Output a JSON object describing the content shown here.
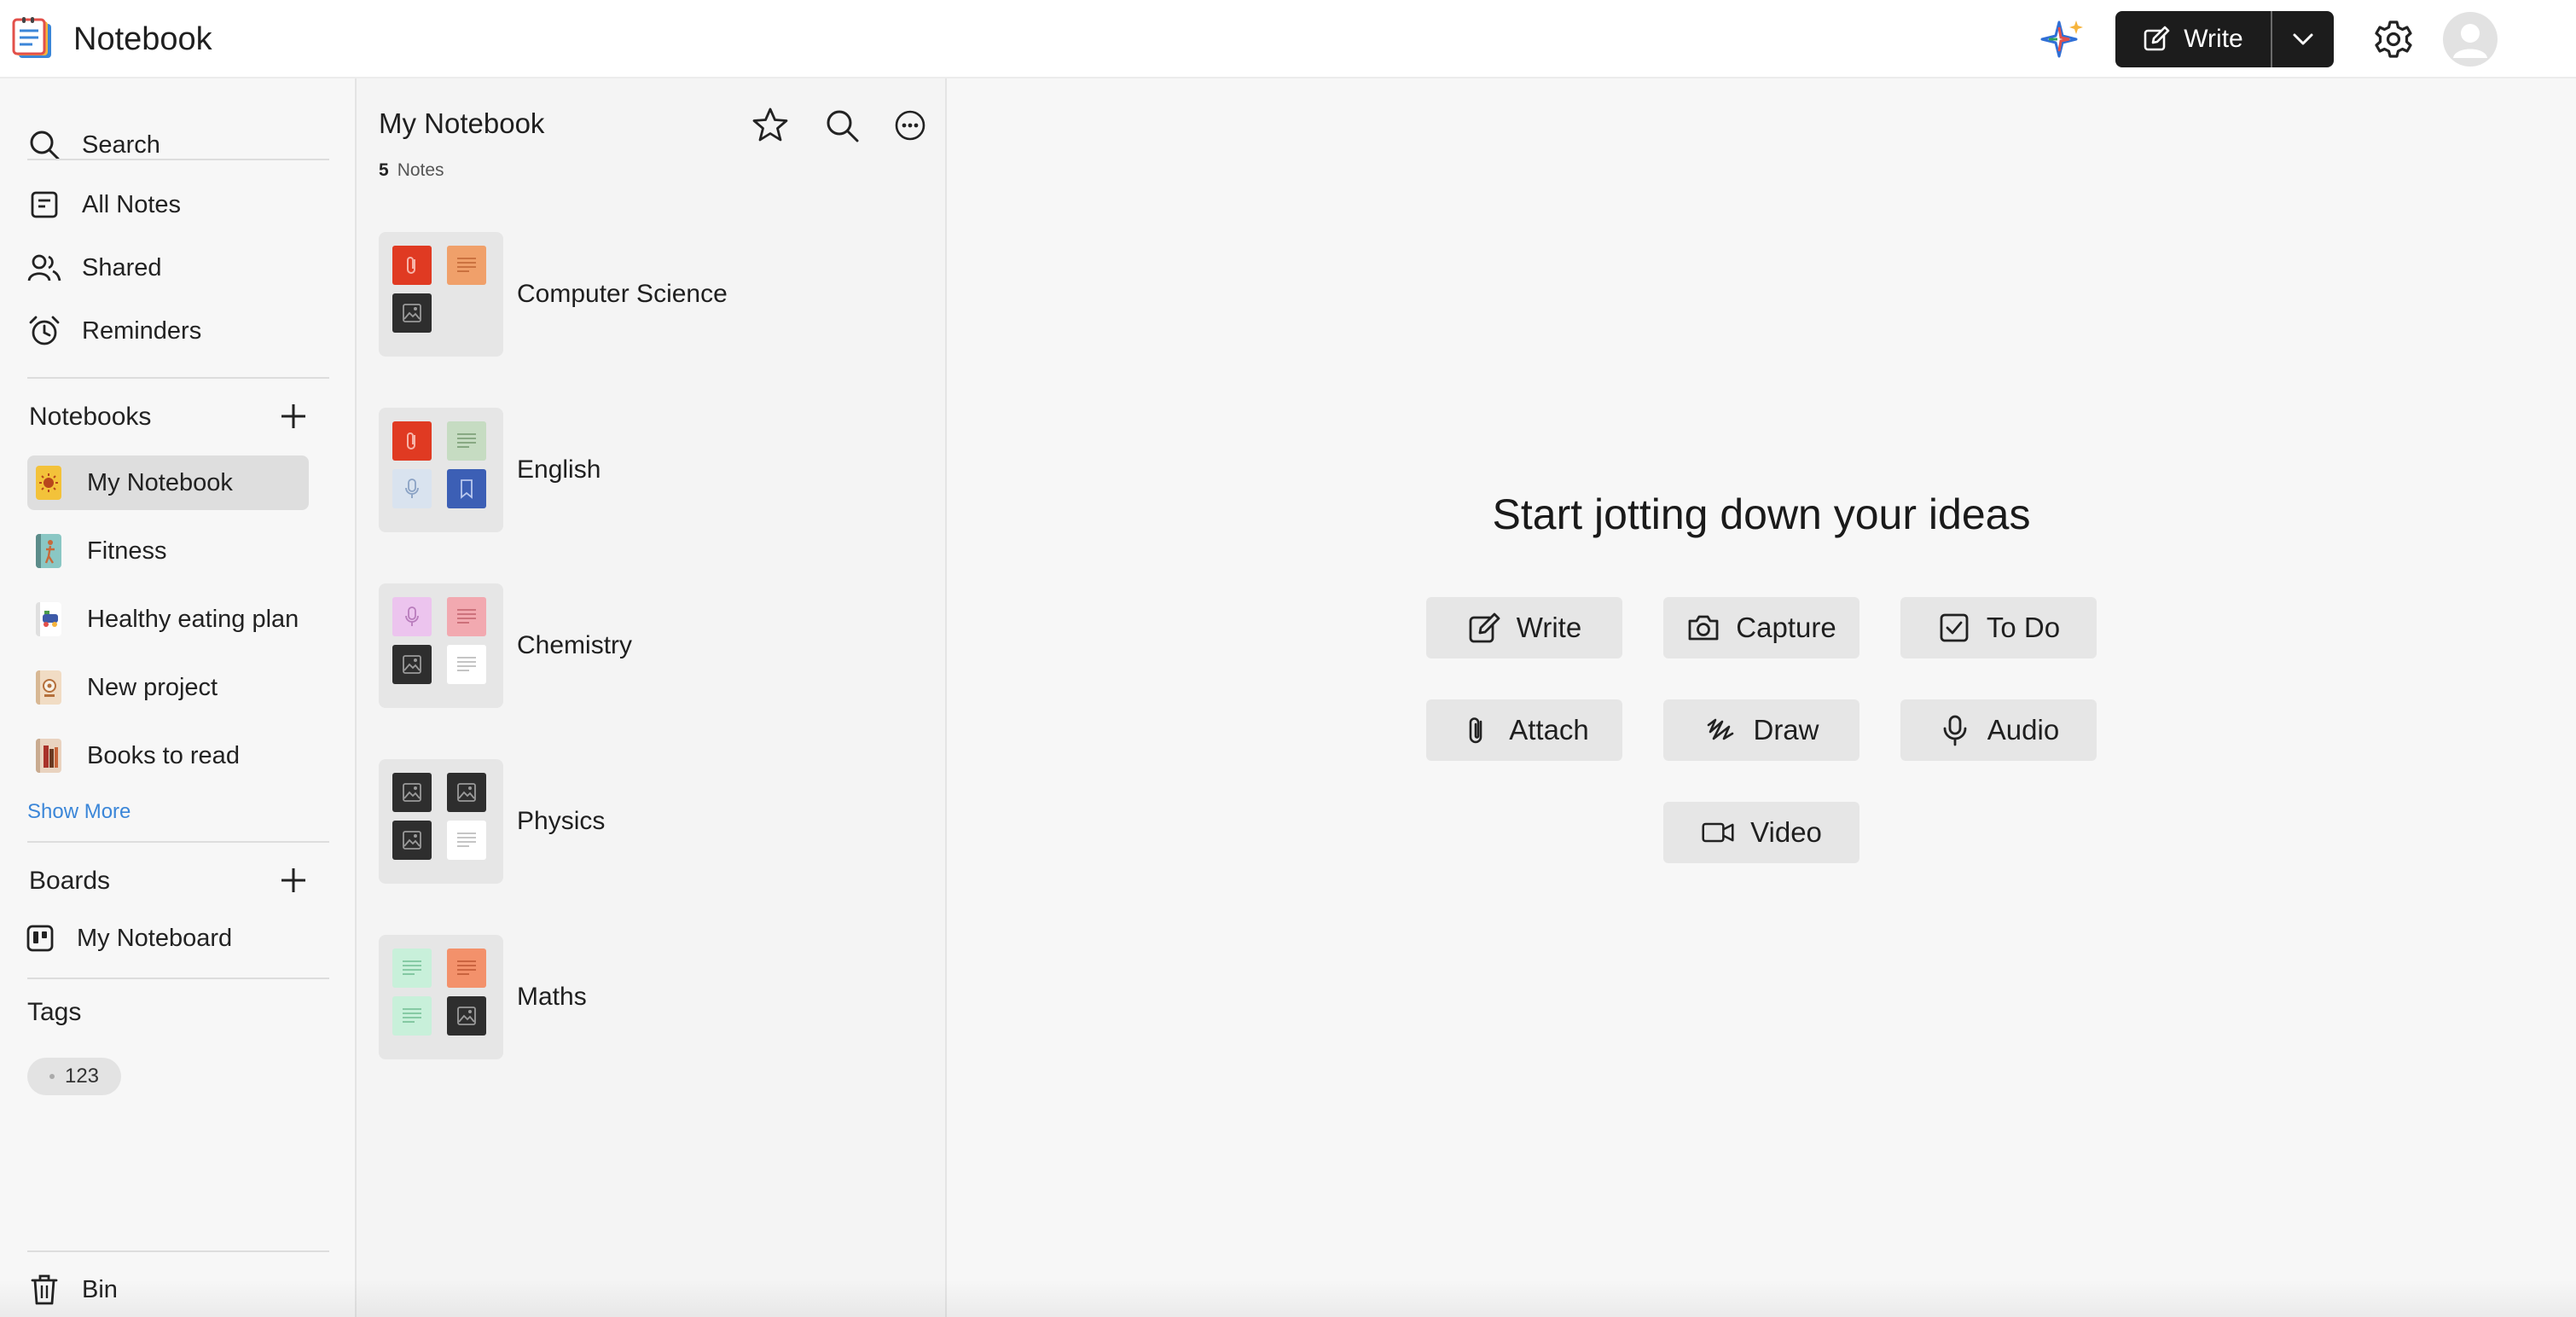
{
  "app": {
    "title": "Notebook"
  },
  "header": {
    "write_label": "Write"
  },
  "sidebar": {
    "search_label": "Search",
    "nav": [
      {
        "label": "All Notes"
      },
      {
        "label": "Shared"
      },
      {
        "label": "Reminders"
      }
    ],
    "notebooks_heading": "Notebooks",
    "notebooks": [
      {
        "label": "My Notebook",
        "active": true
      },
      {
        "label": "Fitness"
      },
      {
        "label": "Healthy eating plan"
      },
      {
        "label": "New project"
      },
      {
        "label": "Books to read"
      }
    ],
    "show_more": "Show More",
    "boards_heading": "Boards",
    "boards": [
      {
        "label": "My Noteboard"
      }
    ],
    "tags_heading": "Tags",
    "tags": [
      {
        "label": "123"
      }
    ],
    "bin_label": "Bin"
  },
  "notes_panel": {
    "title": "My Notebook",
    "count": "5",
    "count_label": "Notes",
    "notebooks": [
      {
        "name": "Computer Science"
      },
      {
        "name": "English"
      },
      {
        "name": "Chemistry"
      },
      {
        "name": "Physics"
      },
      {
        "name": "Maths"
      }
    ]
  },
  "main": {
    "heading": "Start jotting down your ideas",
    "actions": [
      {
        "label": "Write",
        "icon": "pencil-icon"
      },
      {
        "label": "Capture",
        "icon": "camera-icon"
      },
      {
        "label": "To Do",
        "icon": "checkbox-icon"
      },
      {
        "label": "Attach",
        "icon": "paperclip-icon"
      },
      {
        "label": "Draw",
        "icon": "scribble-icon"
      },
      {
        "label": "Audio",
        "icon": "microphone-icon"
      },
      {
        "label": "Video",
        "icon": "video-camera-icon"
      }
    ]
  },
  "colors": {
    "write_button": "#1c1c1c",
    "show_more_link": "#3b86d8",
    "active_notebook_bg": "#dedede",
    "tile_red": "#e03a22",
    "tile_orange": "#f0a06a",
    "tile_dark": "#2e2e2e",
    "tile_green": "#c6dcc2",
    "tile_light_blue": "#d9e3ef",
    "tile_blue": "#3c5fb5",
    "tile_lilac": "#ecc4ee",
    "tile_pink": "#f2a9b0",
    "tile_white": "#ffffff",
    "tile_mint": "#c8f0da",
    "tile_salmon": "#f3916b"
  }
}
